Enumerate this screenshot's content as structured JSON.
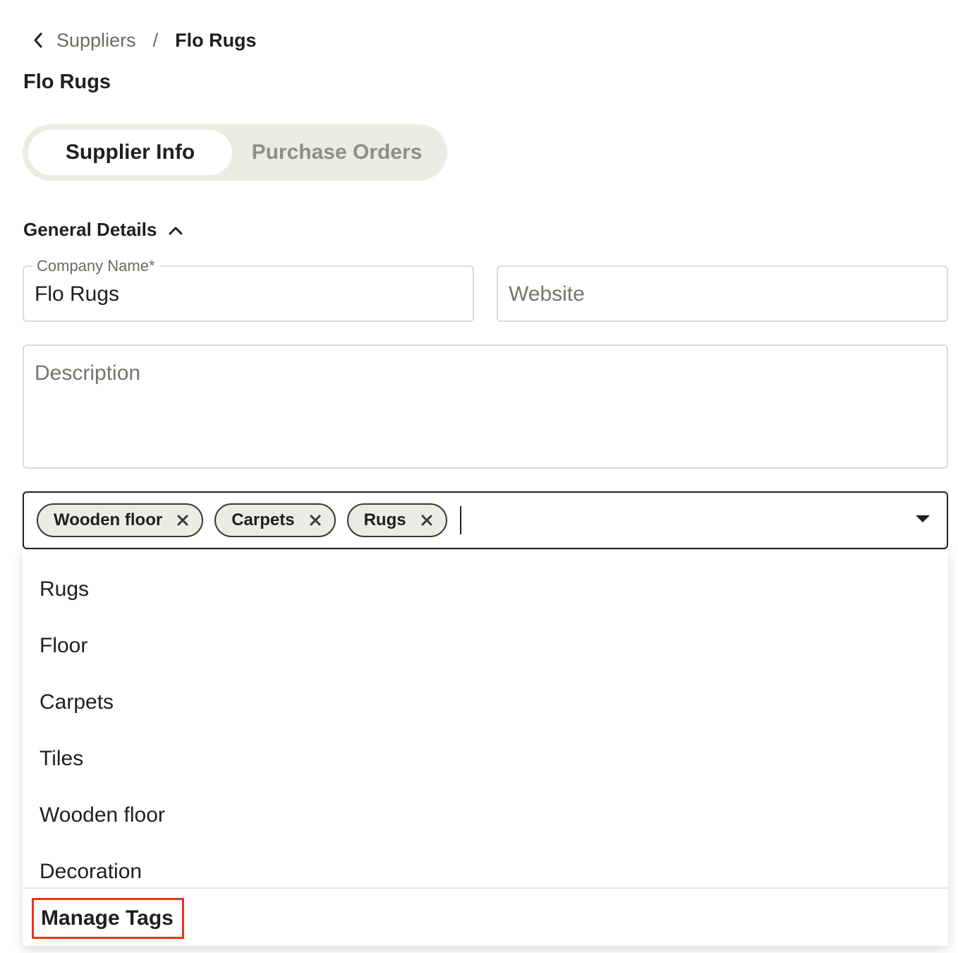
{
  "breadcrumb": {
    "parent": "Suppliers",
    "separator": "/",
    "current": "Flo Rugs"
  },
  "page_title": "Flo Rugs",
  "tabs": [
    {
      "label": "Supplier Info",
      "active": true
    },
    {
      "label": "Purchase Orders",
      "active": false
    }
  ],
  "section": {
    "title": "General Details",
    "expanded": true
  },
  "form": {
    "company_name_label": "Company Name*",
    "company_name_value": "Flo Rugs",
    "website_placeholder": "Website",
    "description_placeholder": "Description"
  },
  "tags": {
    "selected": [
      "Wooden floor",
      "Carpets",
      "Rugs"
    ],
    "options": [
      "Rugs",
      "Floor",
      "Carpets",
      "Tiles",
      "Wooden floor",
      "Decoration"
    ],
    "manage_label": "Manage Tags"
  },
  "colors": {
    "text": "#1f1f1f",
    "muted": "#6b6b63",
    "tab_bg": "#ecece5",
    "border": "#dddbd0",
    "highlight": "#e8361c"
  }
}
